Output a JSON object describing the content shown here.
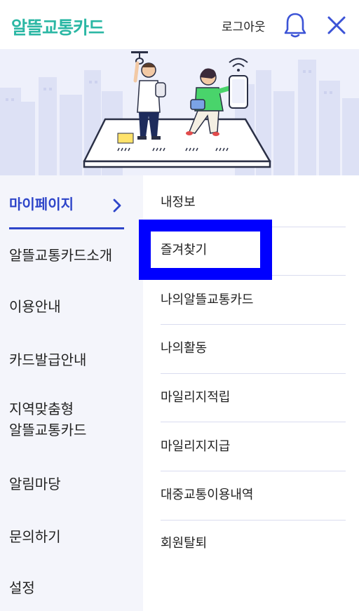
{
  "header": {
    "logo": "알뜰교통카드",
    "logout_label": "로그아웃",
    "bell_icon": "bell-icon",
    "close_icon": "close-icon"
  },
  "colors": {
    "brand": "#2bb7a4",
    "accent": "#2e45c9",
    "highlight": "#0000ff",
    "left_menu_bg": "#f4f5fb"
  },
  "left_menu": {
    "items": [
      {
        "label": "마이페이지",
        "active": true
      },
      {
        "label": "알뜰교통카드소개"
      },
      {
        "label": "이용안내"
      },
      {
        "label": "카드발급안내"
      },
      {
        "label": "지역맞춤형\n알뜰교통카드"
      },
      {
        "label": "알림마당"
      },
      {
        "label": "문의하기"
      },
      {
        "label": "설정"
      }
    ]
  },
  "sub_menu": {
    "items": [
      {
        "label": "내정보"
      },
      {
        "label": "즐겨찾기",
        "highlighted": true
      },
      {
        "label": "나의알뜰교통카드"
      },
      {
        "label": "나의활동"
      },
      {
        "label": "마일리지적립"
      },
      {
        "label": "마일리지지급"
      },
      {
        "label": "대중교통이용내역"
      },
      {
        "label": "회원탈퇴"
      }
    ]
  }
}
